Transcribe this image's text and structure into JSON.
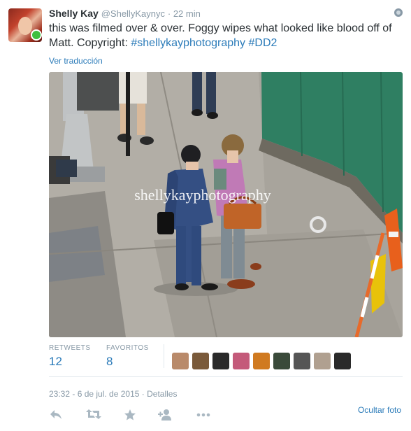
{
  "tweet": {
    "name": "Shelly Kay",
    "handle": "@ShellyKaynyc",
    "time": "22 min",
    "text_plain": "this was filmed over & over. Foggy wipes what looked like blood off of Matt. Copyright: ",
    "hashtag1": "#shellykayphotography",
    "hashtag2": "#DD2",
    "translate": "Ver traducción",
    "watermark": "shellykayphotography",
    "retweets_label": "RETWEETS",
    "retweets_count": "12",
    "favorites_label": "FAVORITOS",
    "favorites_count": "8",
    "timestamp": "23:32 - 6 de jul. de 2015",
    "details": "Detalles",
    "hide_photo": "Ocultar foto"
  },
  "favoriters": [
    {
      "color": "#b98a6a"
    },
    {
      "color": "#7a5a3a"
    },
    {
      "color": "#2a2a2a"
    },
    {
      "color": "#c45a7a"
    },
    {
      "color": "#d07a20"
    },
    {
      "color": "#3a4a3a"
    },
    {
      "color": "#555555"
    },
    {
      "color": "#b0a090"
    },
    {
      "color": "#2a2a2a"
    }
  ],
  "icons": [
    "globe-icon",
    "reply-icon",
    "retweet-icon",
    "favorite-icon",
    "follow-icon",
    "more-icon"
  ],
  "colors": {
    "link": "#2b7bb9",
    "muted": "#8899a6",
    "verified_dot": "#3fbf3f"
  }
}
